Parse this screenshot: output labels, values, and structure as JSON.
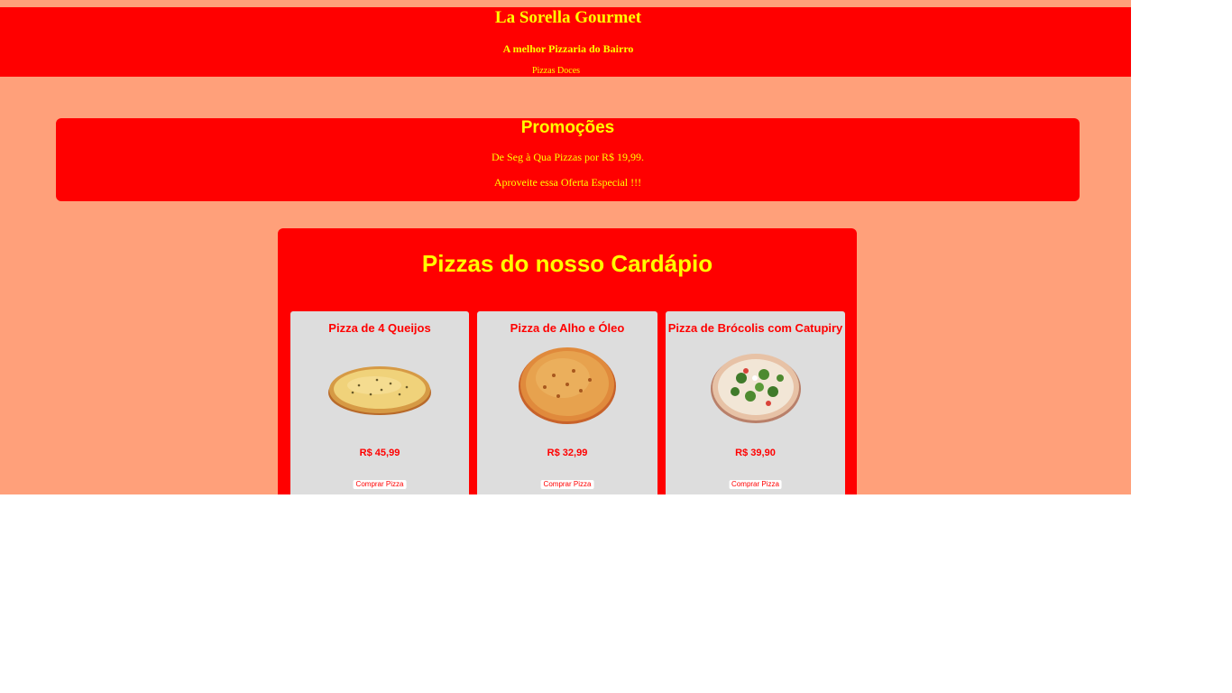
{
  "header": {
    "title": "La Sorella Gourmet",
    "tagline": "A melhor Pizzaria do Bairro",
    "nav_link": "Pizzas Doces"
  },
  "promo": {
    "title": "Promoções",
    "line1": "De Seg à Qua Pizzas por R$ 19,99.",
    "line2": "Aproveite essa Oferta Especial !!!"
  },
  "menu": {
    "title": "Pizzas do nosso Cardápio",
    "items": [
      {
        "name": "Pizza de 4 Queijos",
        "price": "R$ 45,99",
        "button": "Comprar Pizza",
        "image_icon": "four-cheese-pizza-image"
      },
      {
        "name": "Pizza de Alho e Óleo",
        "price": "R$ 32,99",
        "button": "Comprar Pizza",
        "image_icon": "garlic-oil-pizza-image"
      },
      {
        "name": "Pizza de Brócolis com Catupiry",
        "price": "R$ 39,90",
        "button": "Comprar Pizza",
        "image_icon": "broccoli-catupiry-pizza-image"
      }
    ]
  },
  "colors": {
    "page_background": "#ffa07a",
    "accent_red": "#ff0000",
    "text_yellow": "#ffff00",
    "card_background": "#dddddd"
  }
}
